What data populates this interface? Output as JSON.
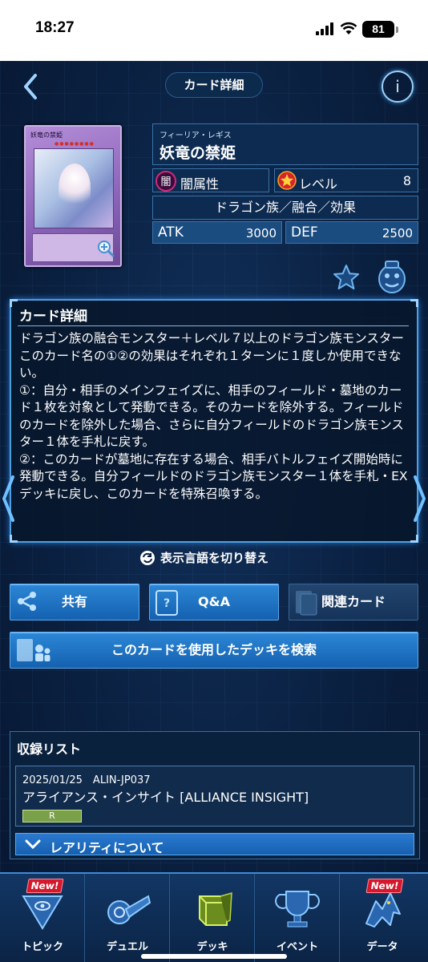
{
  "status_bar": {
    "time": "18:27",
    "battery": "81"
  },
  "header": {
    "title": "カード詳細",
    "info_label": "i"
  },
  "card": {
    "image_name": "妖竜の禁姫",
    "ruby": "フィーリア・レギス",
    "name": "妖竜の禁姫",
    "attribute_icon_text": "闇",
    "attribute": "闇属性",
    "level_label": "レベル",
    "level": "8",
    "type": "ドラゴン族／融合／効果",
    "atk_label": "ATK",
    "atk": "3000",
    "def_label": "DEF",
    "def": "2500"
  },
  "detail_panel": {
    "title": "カード詳細",
    "text": "ドラゴン族の融合モンスター＋レベル７以上のドラゴン族モンスター\nこのカード名の①②の効果はそれぞれ１ターンに１度しか使用できない。\n①：自分・相手のメインフェイズに、相手のフィールド・墓地のカード１枚を対象として発動できる。そのカードを除外する。フィールドのカードを除外した場合、さらに自分フィールドのドラゴン族モンスター１体を手札に戻す。\n②：このカードが墓地に存在する場合、相手バトルフェイズ開始時に発動できる。自分フィールドのドラゴン族モンスター１体を手札・EXデッキに戻し、このカードを特殊召喚する。"
  },
  "language_toggle": "表示言語を切り替え",
  "buttons": {
    "share": "共有",
    "qa": "Q&A",
    "related": "関連カード",
    "search_decks": "このカードを使用したデッキを検索"
  },
  "records": {
    "title": "収録リスト",
    "items": [
      {
        "date_code": "2025/01/25　ALIN-JP037",
        "set": "アライアンス・インサイト [ALLIANCE INSIGHT]",
        "rarity": "R"
      }
    ],
    "rarity_info": "レアリティについて"
  },
  "nav": {
    "items": [
      {
        "label": "トピック",
        "badge": "New!"
      },
      {
        "label": "デュエル",
        "badge": ""
      },
      {
        "label": "デッキ",
        "badge": ""
      },
      {
        "label": "イベント",
        "badge": ""
      },
      {
        "label": "データ",
        "badge": "New!"
      }
    ]
  },
  "colors": {
    "accent": "#2c87d6",
    "panel_border": "#4f9fe0",
    "badge": "#d6182c",
    "rarity": "#7aa04a"
  }
}
